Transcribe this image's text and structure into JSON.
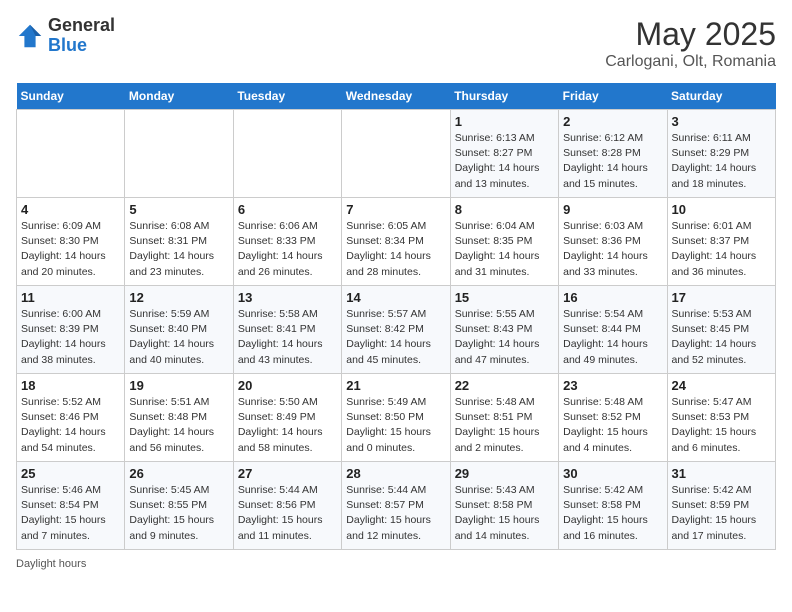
{
  "logo": {
    "general": "General",
    "blue": "Blue"
  },
  "title": "May 2025",
  "subtitle": "Carlogani, Olt, Romania",
  "days_of_week": [
    "Sunday",
    "Monday",
    "Tuesday",
    "Wednesday",
    "Thursday",
    "Friday",
    "Saturday"
  ],
  "weeks": [
    [
      {
        "num": "",
        "detail": ""
      },
      {
        "num": "",
        "detail": ""
      },
      {
        "num": "",
        "detail": ""
      },
      {
        "num": "",
        "detail": ""
      },
      {
        "num": "1",
        "detail": "Sunrise: 6:13 AM\nSunset: 8:27 PM\nDaylight: 14 hours\nand 13 minutes."
      },
      {
        "num": "2",
        "detail": "Sunrise: 6:12 AM\nSunset: 8:28 PM\nDaylight: 14 hours\nand 15 minutes."
      },
      {
        "num": "3",
        "detail": "Sunrise: 6:11 AM\nSunset: 8:29 PM\nDaylight: 14 hours\nand 18 minutes."
      }
    ],
    [
      {
        "num": "4",
        "detail": "Sunrise: 6:09 AM\nSunset: 8:30 PM\nDaylight: 14 hours\nand 20 minutes."
      },
      {
        "num": "5",
        "detail": "Sunrise: 6:08 AM\nSunset: 8:31 PM\nDaylight: 14 hours\nand 23 minutes."
      },
      {
        "num": "6",
        "detail": "Sunrise: 6:06 AM\nSunset: 8:33 PM\nDaylight: 14 hours\nand 26 minutes."
      },
      {
        "num": "7",
        "detail": "Sunrise: 6:05 AM\nSunset: 8:34 PM\nDaylight: 14 hours\nand 28 minutes."
      },
      {
        "num": "8",
        "detail": "Sunrise: 6:04 AM\nSunset: 8:35 PM\nDaylight: 14 hours\nand 31 minutes."
      },
      {
        "num": "9",
        "detail": "Sunrise: 6:03 AM\nSunset: 8:36 PM\nDaylight: 14 hours\nand 33 minutes."
      },
      {
        "num": "10",
        "detail": "Sunrise: 6:01 AM\nSunset: 8:37 PM\nDaylight: 14 hours\nand 36 minutes."
      }
    ],
    [
      {
        "num": "11",
        "detail": "Sunrise: 6:00 AM\nSunset: 8:39 PM\nDaylight: 14 hours\nand 38 minutes."
      },
      {
        "num": "12",
        "detail": "Sunrise: 5:59 AM\nSunset: 8:40 PM\nDaylight: 14 hours\nand 40 minutes."
      },
      {
        "num": "13",
        "detail": "Sunrise: 5:58 AM\nSunset: 8:41 PM\nDaylight: 14 hours\nand 43 minutes."
      },
      {
        "num": "14",
        "detail": "Sunrise: 5:57 AM\nSunset: 8:42 PM\nDaylight: 14 hours\nand 45 minutes."
      },
      {
        "num": "15",
        "detail": "Sunrise: 5:55 AM\nSunset: 8:43 PM\nDaylight: 14 hours\nand 47 minutes."
      },
      {
        "num": "16",
        "detail": "Sunrise: 5:54 AM\nSunset: 8:44 PM\nDaylight: 14 hours\nand 49 minutes."
      },
      {
        "num": "17",
        "detail": "Sunrise: 5:53 AM\nSunset: 8:45 PM\nDaylight: 14 hours\nand 52 minutes."
      }
    ],
    [
      {
        "num": "18",
        "detail": "Sunrise: 5:52 AM\nSunset: 8:46 PM\nDaylight: 14 hours\nand 54 minutes."
      },
      {
        "num": "19",
        "detail": "Sunrise: 5:51 AM\nSunset: 8:48 PM\nDaylight: 14 hours\nand 56 minutes."
      },
      {
        "num": "20",
        "detail": "Sunrise: 5:50 AM\nSunset: 8:49 PM\nDaylight: 14 hours\nand 58 minutes."
      },
      {
        "num": "21",
        "detail": "Sunrise: 5:49 AM\nSunset: 8:50 PM\nDaylight: 15 hours\nand 0 minutes."
      },
      {
        "num": "22",
        "detail": "Sunrise: 5:48 AM\nSunset: 8:51 PM\nDaylight: 15 hours\nand 2 minutes."
      },
      {
        "num": "23",
        "detail": "Sunrise: 5:48 AM\nSunset: 8:52 PM\nDaylight: 15 hours\nand 4 minutes."
      },
      {
        "num": "24",
        "detail": "Sunrise: 5:47 AM\nSunset: 8:53 PM\nDaylight: 15 hours\nand 6 minutes."
      }
    ],
    [
      {
        "num": "25",
        "detail": "Sunrise: 5:46 AM\nSunset: 8:54 PM\nDaylight: 15 hours\nand 7 minutes."
      },
      {
        "num": "26",
        "detail": "Sunrise: 5:45 AM\nSunset: 8:55 PM\nDaylight: 15 hours\nand 9 minutes."
      },
      {
        "num": "27",
        "detail": "Sunrise: 5:44 AM\nSunset: 8:56 PM\nDaylight: 15 hours\nand 11 minutes."
      },
      {
        "num": "28",
        "detail": "Sunrise: 5:44 AM\nSunset: 8:57 PM\nDaylight: 15 hours\nand 12 minutes."
      },
      {
        "num": "29",
        "detail": "Sunrise: 5:43 AM\nSunset: 8:58 PM\nDaylight: 15 hours\nand 14 minutes."
      },
      {
        "num": "30",
        "detail": "Sunrise: 5:42 AM\nSunset: 8:58 PM\nDaylight: 15 hours\nand 16 minutes."
      },
      {
        "num": "31",
        "detail": "Sunrise: 5:42 AM\nSunset: 8:59 PM\nDaylight: 15 hours\nand 17 minutes."
      }
    ]
  ],
  "footer": "Daylight hours"
}
